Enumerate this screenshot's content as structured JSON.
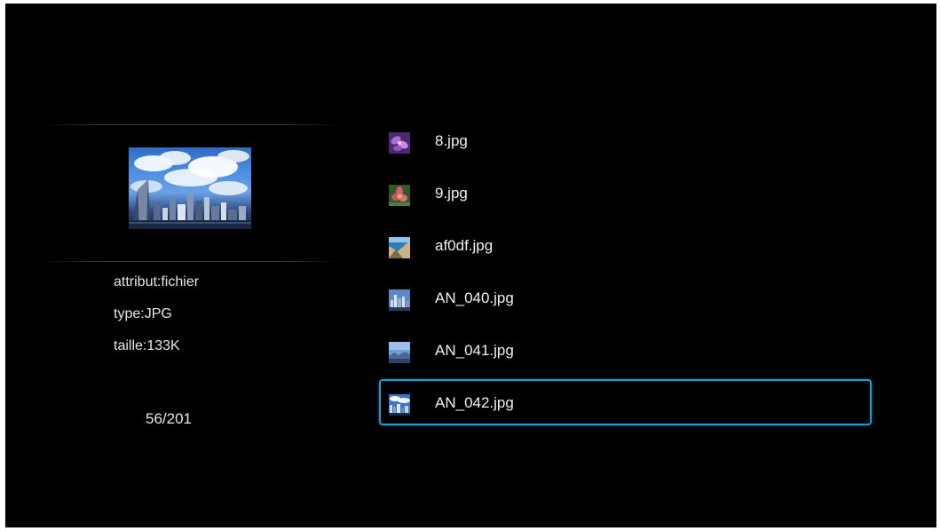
{
  "details": {
    "attribute": "attribut:fichier",
    "type": "type:JPG",
    "size": "taille:133K"
  },
  "counter": "56/201",
  "files": [
    {
      "name": "8.jpg",
      "thumb_icon": "purple-flower-thumbnail-icon"
    },
    {
      "name": "9.jpg",
      "thumb_icon": "pink-flower-thumbnail-icon"
    },
    {
      "name": "af0df.jpg",
      "thumb_icon": "coastal-scene-thumbnail-icon"
    },
    {
      "name": "AN_040.jpg",
      "thumb_icon": "city-skyline-thumbnail-icon"
    },
    {
      "name": "AN_041.jpg",
      "thumb_icon": "landscape-thumbnail-icon"
    },
    {
      "name": "AN_042.jpg",
      "thumb_icon": "city-clouds-thumbnail-icon"
    }
  ],
  "selected_file": "AN_042.jpg",
  "colors": {
    "background": "#000000",
    "selection_border": "#1f9bd0",
    "text": "#f0f0f0"
  }
}
